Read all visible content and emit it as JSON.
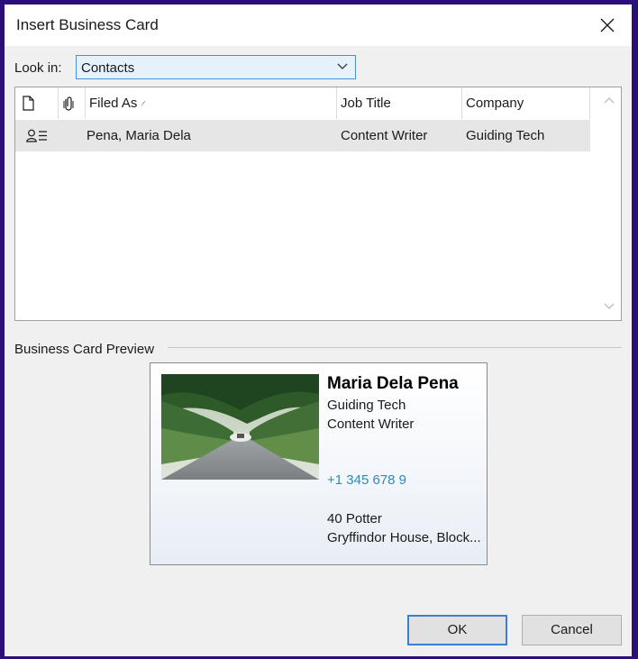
{
  "window": {
    "title": "Insert Business Card"
  },
  "look_in": {
    "label": "Look in:",
    "value": "Contacts"
  },
  "list": {
    "columns": {
      "icon": "document-icon",
      "attachment": "paperclip-icon",
      "filed_as": "Filed As",
      "job_title": "Job Title",
      "company": "Company"
    },
    "rows": [
      {
        "icon": "contact-card-icon",
        "filed_as": "Pena, Maria Dela",
        "job_title": "Content Writer",
        "company": "Guiding Tech"
      }
    ]
  },
  "preview": {
    "label": "Business Card Preview",
    "card": {
      "name": "Maria Dela Pena",
      "company": "Guiding Tech",
      "job_title": "Content Writer",
      "phone": "+1 345 678 9",
      "address_line1": "40 Potter",
      "address_line2": "Gryffindor House, Block..."
    }
  },
  "buttons": {
    "ok": "OK",
    "cancel": "Cancel"
  },
  "colors": {
    "accent": "#3c7fd1",
    "combo_bg": "#e5f1fb",
    "phone": "#2e8bb0",
    "frame": "#2a0f78"
  }
}
